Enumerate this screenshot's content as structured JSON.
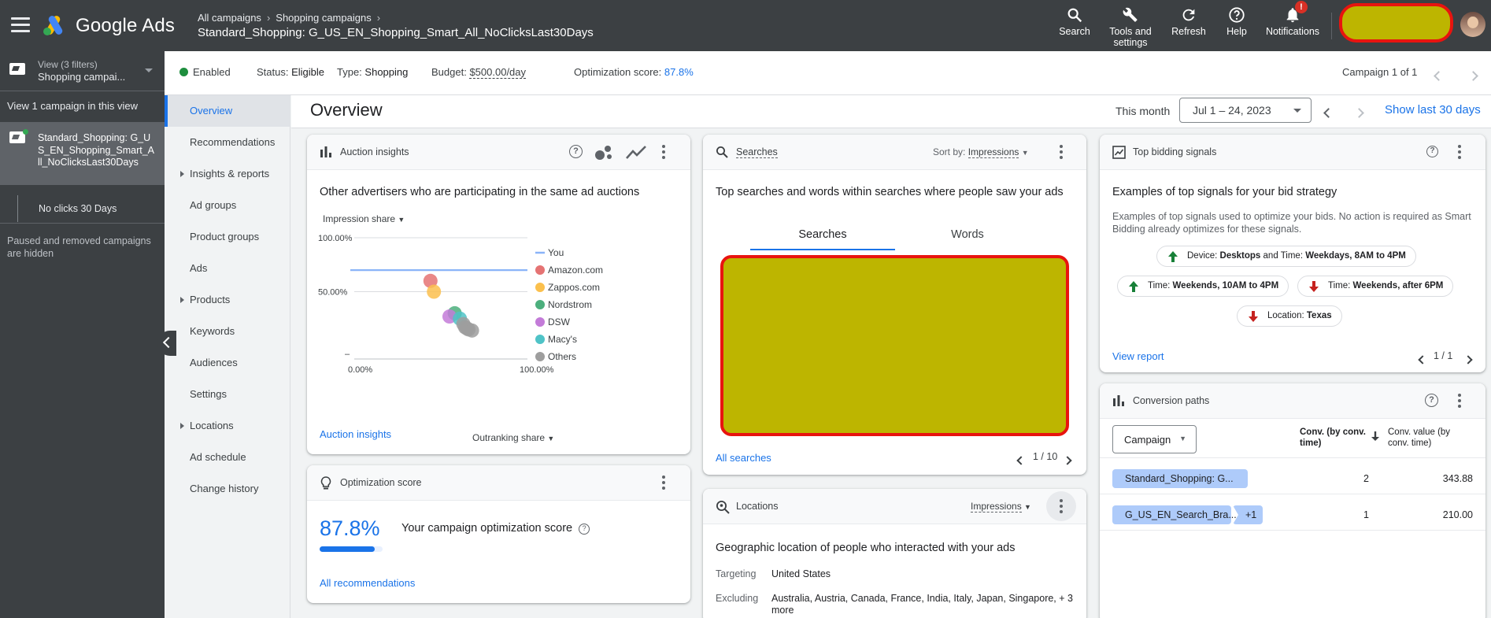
{
  "app": {
    "logo_text": "Google Ads",
    "breadcrumbs": [
      "All campaigns",
      "Shopping campaigns"
    ],
    "campaign_title": "Standard_Shopping: G_US_EN_Shopping_Smart_All_NoClicksLast30Days",
    "actions": {
      "search": "Search",
      "tools_line1": "Tools and",
      "tools_line2": "settings",
      "refresh": "Refresh",
      "help": "Help",
      "notifications": "Notifications",
      "notification_badge": "!"
    }
  },
  "leftnav": {
    "view_label": "View (3 filters)",
    "view_value": "Shopping campai...",
    "view_one": "View 1 campaign in this view",
    "campaign_label": "Standard_Shopping: G_US_EN_Shopping_Smart_All_NoClicksLast30Days",
    "adgroup_label": "No clicks 30 Days",
    "paused_note": "Paused and removed campaigns are hidden"
  },
  "status": {
    "enabled": "Enabled",
    "status_label": "Status:",
    "status_value": "Eligible",
    "type_label": "Type:",
    "type_value": "Shopping",
    "budget_label": "Budget:",
    "budget_value": "$500.00/day",
    "opt_label": "Optimization score:",
    "opt_value": "87.8%",
    "campaign_of": "Campaign 1 of 1"
  },
  "subnav": {
    "items": [
      {
        "label": "Overview",
        "active": true
      },
      {
        "label": "Recommendations"
      },
      {
        "label": "Insights & reports",
        "expand": true
      },
      {
        "label": "Ad groups"
      },
      {
        "label": "Product groups"
      },
      {
        "label": "Ads"
      },
      {
        "label": "Products",
        "expand": true
      },
      {
        "label": "Keywords"
      },
      {
        "label": "Audiences"
      },
      {
        "label": "Settings"
      },
      {
        "label": "Locations",
        "expand": true
      },
      {
        "label": "Ad schedule"
      },
      {
        "label": "Change history"
      }
    ]
  },
  "overview": {
    "title": "Overview",
    "this_month": "This month",
    "date_range": "Jul 1 – 24, 2023",
    "show_last": "Show last 30 days"
  },
  "auction": {
    "title": "Auction insights",
    "subtitle": "Other advertisers who are participating in the same ad auctions",
    "y_metric": "Impression share",
    "x_metric": "Outranking share",
    "link": "Auction insights"
  },
  "chart_data": {
    "type": "scatter",
    "xlabel": "Outranking share",
    "ylabel": "Impression share",
    "xlim": [
      0,
      100
    ],
    "ylim": [
      0,
      100
    ],
    "x_ticks": [
      "0.00%",
      "100.00%"
    ],
    "y_ticks": [
      "100.00%",
      "50.00%",
      "–"
    ],
    "series": [
      {
        "name": "You",
        "kind": "line",
        "color": "#8ab4f8",
        "y": 70
      },
      {
        "name": "Amazon.com",
        "color": "#e57373",
        "points": [
          [
            44,
            60
          ]
        ]
      },
      {
        "name": "Zappos.com",
        "color": "#fbc04d",
        "points": [
          [
            46,
            50
          ]
        ]
      },
      {
        "name": "Nordstrom",
        "color": "#4caf7d",
        "points": [
          [
            58,
            30
          ]
        ]
      },
      {
        "name": "DSW",
        "color": "#c37bd8",
        "points": [
          [
            55,
            27
          ]
        ]
      },
      {
        "name": "Macy's",
        "color": "#4fc3c7",
        "points": [
          [
            61,
            25
          ]
        ]
      },
      {
        "name": "Others",
        "color": "#9e9e9e",
        "points": [
          [
            63,
            20
          ],
          [
            64,
            17
          ],
          [
            66,
            15
          ],
          [
            68,
            14
          ],
          [
            65,
            16
          ]
        ]
      }
    ]
  },
  "optscore": {
    "title": "Optimization score",
    "value": "87.8%",
    "fill_percent": 87.8,
    "label": "Your campaign optimization score",
    "link": "All recommendations"
  },
  "searches": {
    "title": "Searches",
    "sort_label": "Sort by:",
    "sort_value": "Impressions",
    "subtitle": "Top searches and words within searches where people saw your ads",
    "tab_searches": "Searches",
    "tab_words": "Words",
    "link": "All searches",
    "pager": "1 / 10"
  },
  "locations": {
    "title": "Locations",
    "sort_value": "Impressions",
    "subtitle": "Geographic location of people who interacted with your ads",
    "targeting_label": "Targeting",
    "targeting_value": "United States",
    "excluding_label": "Excluding",
    "excluding_value": "Australia, Austria, Canada, France, India, Italy, Japan, Singapore, + 3 more"
  },
  "signals": {
    "title": "Top bidding signals",
    "subtitle": "Examples of top signals for your bid strategy",
    "desc": "Examples of top signals used to optimize your bids. No action is required as Smart Bidding already optimizes for these signals.",
    "chip1_a": "Device: ",
    "chip1_b": "Desktops",
    "chip1_c": " and Time: ",
    "chip1_d": "Weekdays, 8AM to 4PM",
    "chip2_a": "Time: ",
    "chip2_b": "Weekends, 10AM to 4PM",
    "chip3_a": "Time: ",
    "chip3_b": "Weekends, after 6PM",
    "chip4_a": "Location: ",
    "chip4_b": "Texas",
    "link": "View report",
    "pager": "1 / 1",
    "up_color": "#188038",
    "down_color": "#c5221f"
  },
  "convpaths": {
    "title": "Conversion paths",
    "dimension": "Campaign",
    "col1_line1": "Conv. (by conv.",
    "col1_line2": "time)",
    "col2_line1": "Conv. value (by",
    "col2_line2": "conv. time)",
    "rows": [
      {
        "chip": "Standard_Shopping: G...",
        "conv": "2",
        "value": "343.88"
      },
      {
        "chip": "G_US_EN_Search_Bra...",
        "extra": "+1",
        "conv": "1",
        "value": "210.00"
      }
    ]
  }
}
